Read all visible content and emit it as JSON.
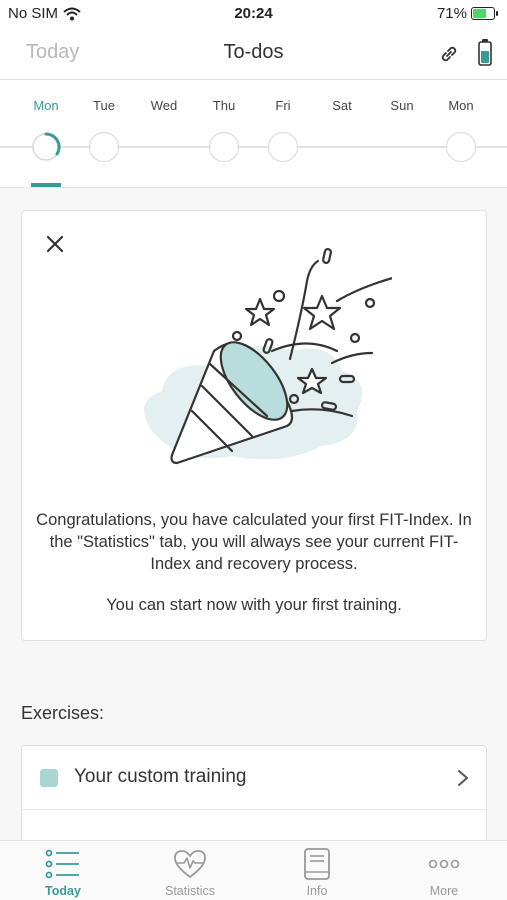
{
  "status_bar": {
    "carrier": "No SIM",
    "time": "20:24",
    "battery_percent": "71%",
    "battery_level": 0.71
  },
  "nav": {
    "left": "Today",
    "title": "To-dos"
  },
  "week": {
    "days": [
      "Mon",
      "Tue",
      "Wed",
      "Thu",
      "Fri",
      "Sat",
      "Sun",
      "Mon"
    ],
    "active_index": 0
  },
  "card": {
    "message": "Congratulations, you have calculated your first FIT-Index. In the \"Statistics\" tab, you will always see your current FIT-Index and recovery process.",
    "message2": "You can start now with your first training."
  },
  "exercises": {
    "title": "Exercises:",
    "items": [
      {
        "label": "Your custom training"
      }
    ]
  },
  "tabs": [
    {
      "label": "Today",
      "icon": "list-icon",
      "active": true
    },
    {
      "label": "Statistics",
      "icon": "heart-pulse-icon",
      "active": false
    },
    {
      "label": "Info",
      "icon": "book-icon",
      "active": false
    },
    {
      "label": "More",
      "icon": "more-dots-icon",
      "active": false
    }
  ],
  "colors": {
    "accent": "#3a9a96",
    "exercise_square": "#a9d5d3"
  }
}
